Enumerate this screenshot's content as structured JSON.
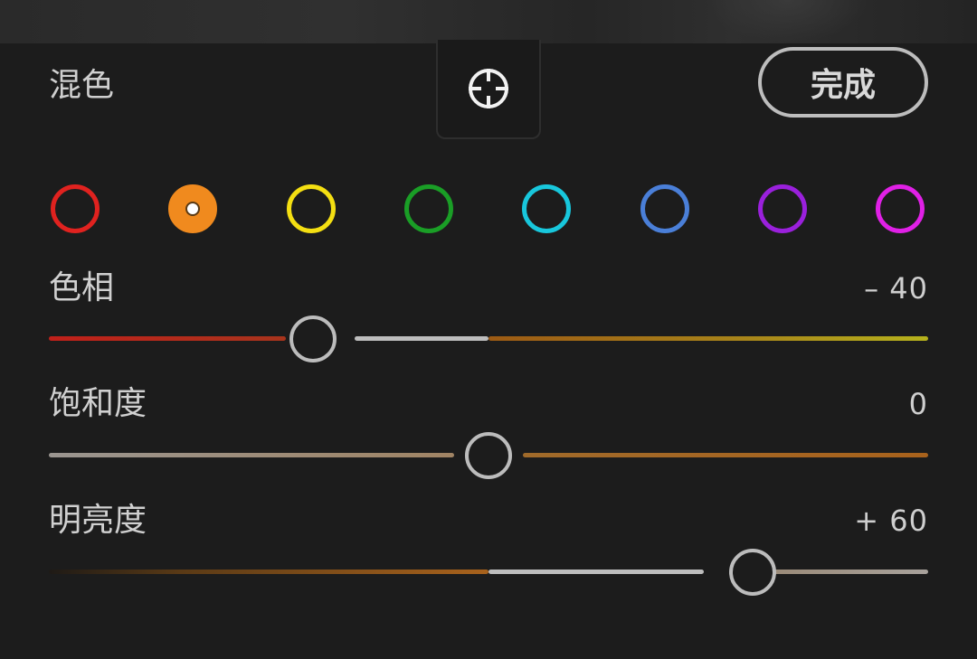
{
  "panel": {
    "title": "混色",
    "done_label": "完成",
    "target_tool_icon": "crosshair-target-icon"
  },
  "color_swatches": [
    {
      "name": "red",
      "color": "#e0221f",
      "selected": false
    },
    {
      "name": "orange",
      "color": "#f08a1e",
      "selected": true
    },
    {
      "name": "yellow",
      "color": "#f4df12",
      "selected": false
    },
    {
      "name": "green",
      "color": "#1a9e26",
      "selected": false
    },
    {
      "name": "aqua",
      "color": "#18c7dc",
      "selected": false
    },
    {
      "name": "blue",
      "color": "#4a7fd8",
      "selected": false
    },
    {
      "name": "purple",
      "color": "#9a20dc",
      "selected": false
    },
    {
      "name": "magenta",
      "color": "#e020e6",
      "selected": false
    }
  ],
  "sliders": {
    "hue": {
      "label": "色相",
      "value_text": "– 40",
      "value": -40,
      "min": -100,
      "max": 100
    },
    "saturation": {
      "label": "饱和度",
      "value_text": "0",
      "value": 0,
      "min": -100,
      "max": 100
    },
    "luminance": {
      "label": "明亮度",
      "value_text": "+ 60",
      "value": 60,
      "min": -100,
      "max": 100
    }
  },
  "colors": {
    "background": "#1c1c1c",
    "control_outline": "#bdbdbd"
  }
}
